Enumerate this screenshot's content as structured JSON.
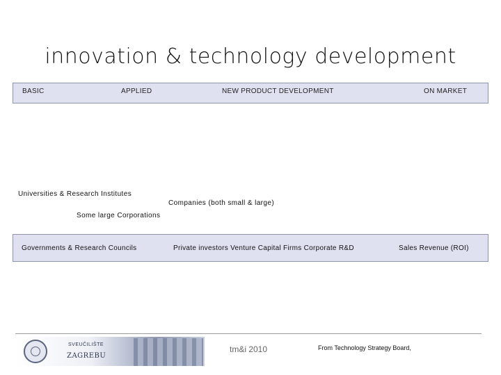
{
  "title": "innovation & technology development",
  "stages": [
    "BASIC",
    "APPLIED",
    "NEW PRODUCT DEVELOPMENT",
    "ON MARKET"
  ],
  "actors": {
    "universities": "Universities & Research Institutes",
    "companies": "Companies (both small & large)",
    "corporations": "Some large Corporations"
  },
  "funding": {
    "governments": "Governments & Research Councils",
    "investors": "Private investors Venture Capital Firms Corporate R&D",
    "sales": "Sales Revenue (ROI)"
  },
  "footer": {
    "logo_line1": "SVEUČILIŠTE",
    "logo_line2": "ZAGREBU",
    "event": "tm&i 2010",
    "source": "From Technology Strategy Board,"
  },
  "colors": {
    "bar_fill": "#dfe1f0",
    "bar_border": "#8f93aa"
  }
}
